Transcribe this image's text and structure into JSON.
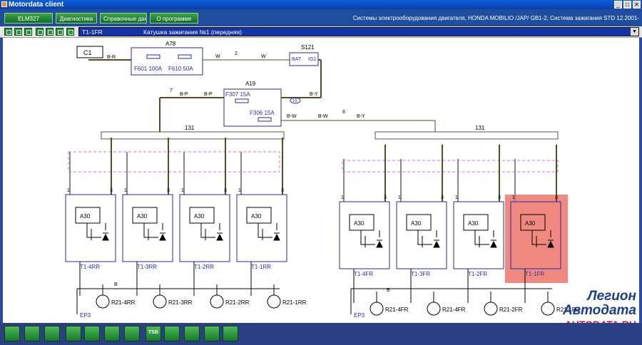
{
  "window": {
    "title": "Motordata client",
    "controls": [
      "_",
      "□",
      "✕"
    ]
  },
  "menu": {
    "items": [
      "ELM327",
      "Диагностика",
      "Справочные данные",
      "О программе"
    ],
    "vehicle_info": "Системы электрооборудования двигателя,  HONDA  MOBILIO /JAP/ GB1-2,  Система зажигания  STD  12.2001-"
  },
  "toolbar": {
    "diagram_code": "T1-1FR",
    "diagram_name": "Катушка зажигания №1 (передняя)",
    "icon_names": [
      "home-icon",
      "print-icon",
      "zoom-icon",
      "save-icon",
      "edit-icon",
      "pen-icon",
      "pointer-icon"
    ]
  },
  "diagram": {
    "labels": {
      "c1": "C1",
      "a78": "A78",
      "f601": "F601 100A",
      "f610": "F610 50A",
      "s121": "S121",
      "bat": "BAT",
      "ig1": "IG1",
      "a19": "A19",
      "f307": "F307 15A",
      "f306": "F306 15A",
      "w": "W",
      "br": "B-R",
      "bp": "B-P",
      "by": "B-Y",
      "bw": "B-W",
      "n2": "2",
      "n7": "7",
      "n8": "8",
      "n1": "1",
      "n15": "15",
      "bus_left": "131",
      "bus_right": "131",
      "a30": "A30",
      "ep3": "EP3",
      "b": "B"
    },
    "coils_rear": [
      "T1-4RR",
      "T1-3RR",
      "T1-2RR",
      "T1-1RR"
    ],
    "coils_front": [
      "T1-4FR",
      "T1-3FR",
      "T1-2FR",
      "T1-1FR"
    ],
    "resistors_rear": [
      "R21-4RR",
      "R21-3RR",
      "R21-2RR",
      "R21-1RR"
    ],
    "resistors_front": [
      "R21-4FR",
      "R21-4FR",
      "R21-2FR",
      "R21-1FR"
    ],
    "highlight_color": "#f08a80",
    "wire_color": "#5a4a1e"
  },
  "bottom_toolbar": {
    "buttons": [
      {
        "icon": "back-icon",
        "label": ""
      },
      {
        "icon": "globe-icon",
        "label": ""
      },
      {
        "icon": "gauge-icon",
        "label": ""
      },
      {
        "icon": "component-icon",
        "label": ""
      },
      {
        "icon": "schematic-icon",
        "label": ""
      },
      {
        "icon": "parameters-icon",
        "label": ""
      },
      {
        "icon": "tools-icon",
        "label": ""
      },
      {
        "icon": "tsb-icon",
        "label": "TSB"
      },
      {
        "icon": "car-icon",
        "label": ""
      },
      {
        "icon": "diagnostic-icon",
        "label": ""
      },
      {
        "icon": "table-icon",
        "label": ""
      },
      {
        "icon": "forward-icon",
        "label": ""
      }
    ]
  },
  "watermark": {
    "line1": "Легион",
    "line2": "Автодата",
    "url": "AUTODATA.RU"
  }
}
